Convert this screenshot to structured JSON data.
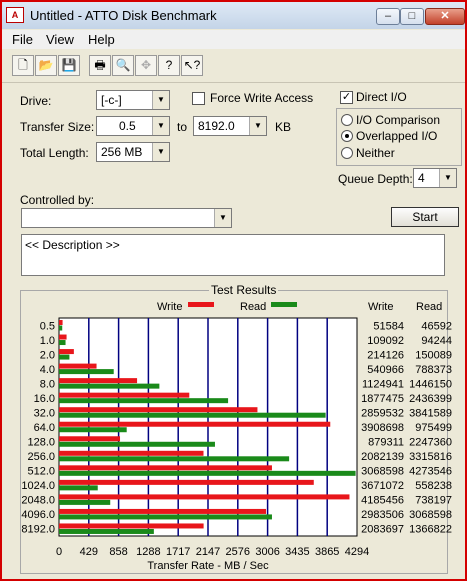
{
  "window": {
    "title": "Untitled - ATTO Disk Benchmark",
    "buttons": [
      "–",
      "□",
      "✕"
    ]
  },
  "menu": [
    "File",
    "View",
    "Help"
  ],
  "toolbar": [
    "new-icon",
    "open-icon",
    "save-icon",
    "print-icon",
    "print-preview-icon",
    "move-icon",
    "help-icon",
    "context-help-icon"
  ],
  "settings": {
    "drive_label": "Drive:",
    "drive_value": "[-c-]",
    "transfer_size_label": "Transfer Size:",
    "transfer_from": "0.5",
    "transfer_to_label": "to",
    "transfer_to": "8192.0",
    "transfer_unit": "KB",
    "total_length_label": "Total Length:",
    "total_length_value": "256 MB",
    "force_write_label": "Force Write Access",
    "force_write_checked": false,
    "direct_io_label": "Direct I/O",
    "direct_io_checked": true,
    "io_comparison_label": "I/O Comparison",
    "overlapped_label": "Overlapped I/O",
    "neither_label": "Neither",
    "selected_mode": "Overlapped I/O",
    "queue_depth_label": "Queue Depth:",
    "queue_depth_value": "4",
    "controlled_by_label": "Controlled by:",
    "controlled_by_value": "",
    "start_label": "Start",
    "description": "<< Description >>"
  },
  "results": {
    "title": "Test Results",
    "write_header": "Write",
    "read_header": "Read",
    "legend_write": "Write",
    "legend_read": "Read"
  },
  "chart_data": {
    "type": "bar",
    "orientation": "horizontal",
    "xlabel": "Transfer Rate - MB / Sec",
    "xlim": [
      0,
      4294
    ],
    "xticks": [
      "0",
      "429",
      "858",
      "1288",
      "1717",
      "2147",
      "2576",
      "3006",
      "3435",
      "3865",
      "4294"
    ],
    "categories": [
      "0.5",
      "1.0",
      "2.0",
      "4.0",
      "8.0",
      "16.0",
      "32.0",
      "64.0",
      "128.0",
      "256.0",
      "512.0",
      "1024.0",
      "2048.0",
      "4096.0",
      "8192.0"
    ],
    "series": [
      {
        "name": "Write",
        "color": "#e8161b",
        "values": [
          51584,
          109092,
          214126,
          540966,
          1124941,
          1877475,
          2859532,
          3908698,
          879311,
          2082139,
          3068598,
          3671072,
          4185456,
          2983506,
          2083697
        ]
      },
      {
        "name": "Read",
        "color": "#1a8a1a",
        "values": [
          46592,
          94244,
          150089,
          788373,
          1446150,
          2436399,
          3841589,
          975499,
          2247360,
          3315816,
          4273546,
          558238,
          738197,
          3068598,
          1366822
        ]
      }
    ],
    "value_units": "KB/s",
    "grid": true
  },
  "colors": {
    "write": "#e8161b",
    "read": "#1a8a1a",
    "grid": "#000080",
    "window_border": "#d40000"
  }
}
